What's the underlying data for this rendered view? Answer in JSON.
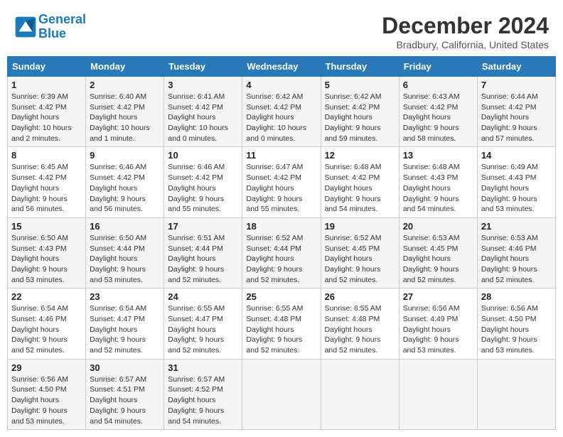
{
  "header": {
    "logo_line1": "General",
    "logo_line2": "Blue",
    "month_title": "December 2024",
    "location": "Bradbury, California, United States"
  },
  "weekdays": [
    "Sunday",
    "Monday",
    "Tuesday",
    "Wednesday",
    "Thursday",
    "Friday",
    "Saturday"
  ],
  "weeks": [
    [
      {
        "day": "1",
        "sunrise": "6:39 AM",
        "sunset": "4:42 PM",
        "daylight": "10 hours and 2 minutes."
      },
      {
        "day": "2",
        "sunrise": "6:40 AM",
        "sunset": "4:42 PM",
        "daylight": "10 hours and 1 minute."
      },
      {
        "day": "3",
        "sunrise": "6:41 AM",
        "sunset": "4:42 PM",
        "daylight": "10 hours and 0 minutes."
      },
      {
        "day": "4",
        "sunrise": "6:42 AM",
        "sunset": "4:42 PM",
        "daylight": "10 hours and 0 minutes."
      },
      {
        "day": "5",
        "sunrise": "6:42 AM",
        "sunset": "4:42 PM",
        "daylight": "9 hours and 59 minutes."
      },
      {
        "day": "6",
        "sunrise": "6:43 AM",
        "sunset": "4:42 PM",
        "daylight": "9 hours and 58 minutes."
      },
      {
        "day": "7",
        "sunrise": "6:44 AM",
        "sunset": "4:42 PM",
        "daylight": "9 hours and 57 minutes."
      }
    ],
    [
      {
        "day": "8",
        "sunrise": "6:45 AM",
        "sunset": "4:42 PM",
        "daylight": "9 hours and 56 minutes."
      },
      {
        "day": "9",
        "sunrise": "6:46 AM",
        "sunset": "4:42 PM",
        "daylight": "9 hours and 56 minutes."
      },
      {
        "day": "10",
        "sunrise": "6:46 AM",
        "sunset": "4:42 PM",
        "daylight": "9 hours and 55 minutes."
      },
      {
        "day": "11",
        "sunrise": "6:47 AM",
        "sunset": "4:42 PM",
        "daylight": "9 hours and 55 minutes."
      },
      {
        "day": "12",
        "sunrise": "6:48 AM",
        "sunset": "4:42 PM",
        "daylight": "9 hours and 54 minutes."
      },
      {
        "day": "13",
        "sunrise": "6:48 AM",
        "sunset": "4:43 PM",
        "daylight": "9 hours and 54 minutes."
      },
      {
        "day": "14",
        "sunrise": "6:49 AM",
        "sunset": "4:43 PM",
        "daylight": "9 hours and 53 minutes."
      }
    ],
    [
      {
        "day": "15",
        "sunrise": "6:50 AM",
        "sunset": "4:43 PM",
        "daylight": "9 hours and 53 minutes."
      },
      {
        "day": "16",
        "sunrise": "6:50 AM",
        "sunset": "4:44 PM",
        "daylight": "9 hours and 53 minutes."
      },
      {
        "day": "17",
        "sunrise": "6:51 AM",
        "sunset": "4:44 PM",
        "daylight": "9 hours and 52 minutes."
      },
      {
        "day": "18",
        "sunrise": "6:52 AM",
        "sunset": "4:44 PM",
        "daylight": "9 hours and 52 minutes."
      },
      {
        "day": "19",
        "sunrise": "6:52 AM",
        "sunset": "4:45 PM",
        "daylight": "9 hours and 52 minutes."
      },
      {
        "day": "20",
        "sunrise": "6:53 AM",
        "sunset": "4:45 PM",
        "daylight": "9 hours and 52 minutes."
      },
      {
        "day": "21",
        "sunrise": "6:53 AM",
        "sunset": "4:46 PM",
        "daylight": "9 hours and 52 minutes."
      }
    ],
    [
      {
        "day": "22",
        "sunrise": "6:54 AM",
        "sunset": "4:46 PM",
        "daylight": "9 hours and 52 minutes."
      },
      {
        "day": "23",
        "sunrise": "6:54 AM",
        "sunset": "4:47 PM",
        "daylight": "9 hours and 52 minutes."
      },
      {
        "day": "24",
        "sunrise": "6:55 AM",
        "sunset": "4:47 PM",
        "daylight": "9 hours and 52 minutes."
      },
      {
        "day": "25",
        "sunrise": "6:55 AM",
        "sunset": "4:48 PM",
        "daylight": "9 hours and 52 minutes."
      },
      {
        "day": "26",
        "sunrise": "6:55 AM",
        "sunset": "4:48 PM",
        "daylight": "9 hours and 52 minutes."
      },
      {
        "day": "27",
        "sunrise": "6:56 AM",
        "sunset": "4:49 PM",
        "daylight": "9 hours and 53 minutes."
      },
      {
        "day": "28",
        "sunrise": "6:56 AM",
        "sunset": "4:50 PM",
        "daylight": "9 hours and 53 minutes."
      }
    ],
    [
      {
        "day": "29",
        "sunrise": "6:56 AM",
        "sunset": "4:50 PM",
        "daylight": "9 hours and 53 minutes."
      },
      {
        "day": "30",
        "sunrise": "6:57 AM",
        "sunset": "4:51 PM",
        "daylight": "9 hours and 54 minutes."
      },
      {
        "day": "31",
        "sunrise": "6:57 AM",
        "sunset": "4:52 PM",
        "daylight": "9 hours and 54 minutes."
      },
      null,
      null,
      null,
      null
    ]
  ]
}
